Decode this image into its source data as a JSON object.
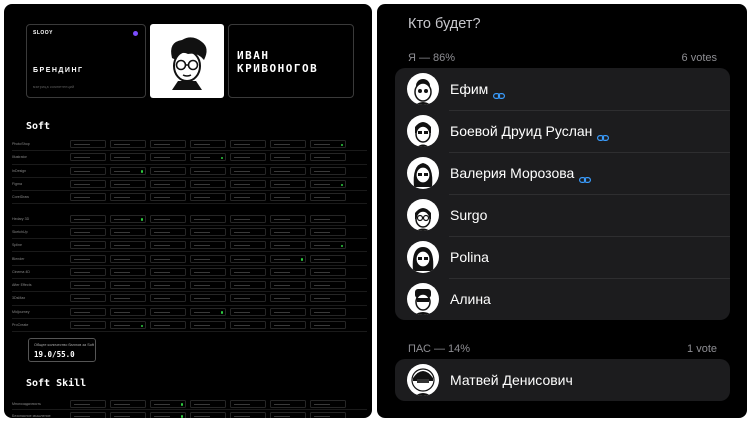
{
  "portfolio": {
    "brand_logo": "SLOOY",
    "brand_title": "БРЕНДИНГ",
    "brand_subtitle": "матрица компетенций",
    "name_line1": "ИВАН",
    "name_line2": "КРИВОНОГОВ",
    "soft_title": "Soft",
    "soft_rows": [
      "PhotoShop",
      "Illustrator",
      "InDesign",
      "Figma",
      "CorelDraw",
      "Hedary 3D",
      "SketchUp",
      "Spline",
      "Blender",
      "Cinema 4D",
      "After Effects",
      "3DsMax",
      "Midjourney",
      "ProCreate"
    ],
    "score_label": "Общее количество баллов за Soft",
    "score_value": "19.0/55.0",
    "softskill_title": "Soft Skill",
    "softskill_rows": [
      "Многозадачность",
      "Безопасное мышление"
    ]
  },
  "poll": {
    "title": "Кто будет?",
    "options": [
      {
        "label": "Я — 86%",
        "votes": "6 votes",
        "voters": [
          {
            "name": "Ефим",
            "linked": true
          },
          {
            "name": "Боевой Друид Руслан",
            "linked": true
          },
          {
            "name": "Валерия Морозова",
            "linked": true
          },
          {
            "name": "Surgo",
            "linked": false
          },
          {
            "name": "Polina",
            "linked": false
          },
          {
            "name": "Алина",
            "linked": false
          }
        ]
      },
      {
        "label": "ПАС — 14%",
        "votes": "1 vote",
        "voters": [
          {
            "name": "Матвей Денисович",
            "linked": false
          }
        ]
      }
    ],
    "colors": {
      "panel": "#1c1c1e",
      "link": "#3a9dff",
      "background": "#000000"
    }
  }
}
